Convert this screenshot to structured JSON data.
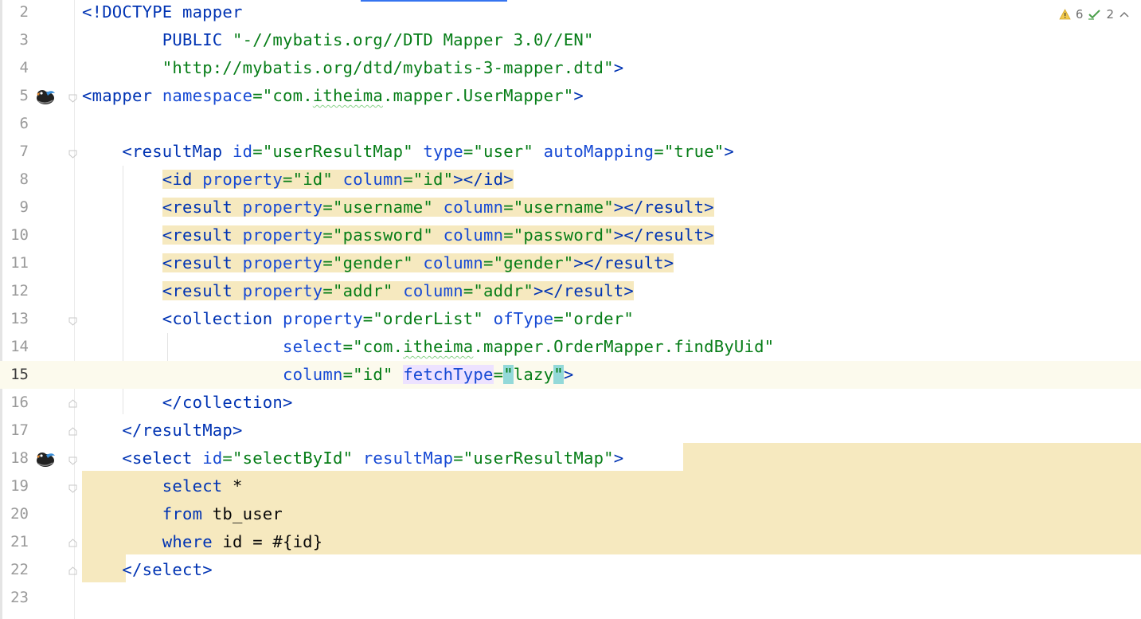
{
  "status": {
    "warnings": "6",
    "checks": "2"
  },
  "lines": [
    {
      "n": "2",
      "text": "<!DOCTYPE mapper"
    },
    {
      "n": "3",
      "text": "        PUBLIC \"-//mybatis.org//DTD Mapper 3.0//EN\""
    },
    {
      "n": "4",
      "text": "        \"http://mybatis.org/dtd/mybatis-3-mapper.dtd\">"
    },
    {
      "n": "5",
      "text": "<mapper namespace=\"com.itheima.mapper.UserMapper\">"
    },
    {
      "n": "6",
      "text": ""
    },
    {
      "n": "7",
      "text": "    <resultMap id=\"userResultMap\" type=\"user\" autoMapping=\"true\">"
    },
    {
      "n": "8",
      "text": "        <id property=\"id\" column=\"id\"></id>"
    },
    {
      "n": "9",
      "text": "        <result property=\"username\" column=\"username\"></result>"
    },
    {
      "n": "10",
      "text": "        <result property=\"password\" column=\"password\"></result>"
    },
    {
      "n": "11",
      "text": "        <result property=\"gender\" column=\"gender\"></result>"
    },
    {
      "n": "12",
      "text": "        <result property=\"addr\" column=\"addr\"></result>"
    },
    {
      "n": "13",
      "text": "        <collection property=\"orderList\" ofType=\"order\""
    },
    {
      "n": "14",
      "text": "                    select=\"com.itheima.mapper.OrderMapper.findByUid\""
    },
    {
      "n": "15",
      "text": "                    column=\"id\" fetchType=\"lazy\">"
    },
    {
      "n": "16",
      "text": "        </collection>"
    },
    {
      "n": "17",
      "text": "    </resultMap>"
    },
    {
      "n": "18",
      "text": "    <select id=\"selectById\" resultMap=\"userResultMap\">"
    },
    {
      "n": "19",
      "text": "        select *"
    },
    {
      "n": "20",
      "text": "        from tb_user"
    },
    {
      "n": "21",
      "text": "        where id = #{id}"
    },
    {
      "n": "22",
      "text": "    </select>"
    },
    {
      "n": "23",
      "text": ""
    }
  ],
  "colors": {
    "tag": "#0033b3",
    "string": "#067d17",
    "highlight": "#f6e9bf",
    "current_line": "#fcfaed",
    "brace_match": "#93d9d9"
  },
  "icons": [
    "mybatis-bird-icon",
    "fold-icon",
    "warning-icon",
    "check-icon",
    "chevron-up-icon"
  ]
}
